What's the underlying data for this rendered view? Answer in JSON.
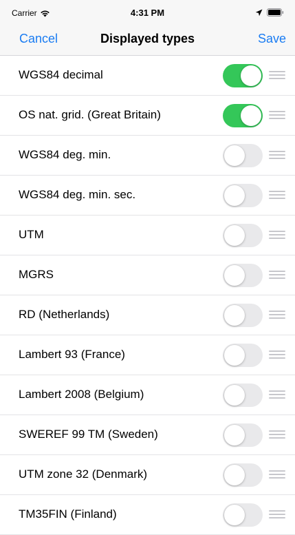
{
  "status_bar": {
    "carrier": "Carrier",
    "time": "4:31 PM",
    "icons": [
      "wifi-icon",
      "location-arrow-icon",
      "battery-icon"
    ]
  },
  "nav": {
    "cancel_label": "Cancel",
    "title": "Displayed types",
    "save_label": "Save"
  },
  "colors": {
    "accent": "#1a7cf2",
    "switch_on": "#34c759",
    "switch_off": "#e9e9eb",
    "separator": "#e3e3e6"
  },
  "types": [
    {
      "label": "WGS84 decimal",
      "enabled": true
    },
    {
      "label": "OS nat. grid. (Great Britain)",
      "enabled": true
    },
    {
      "label": "WGS84 deg. min.",
      "enabled": false
    },
    {
      "label": "WGS84 deg. min. sec.",
      "enabled": false
    },
    {
      "label": "UTM",
      "enabled": false
    },
    {
      "label": "MGRS",
      "enabled": false
    },
    {
      "label": "RD (Netherlands)",
      "enabled": false
    },
    {
      "label": "Lambert 93 (France)",
      "enabled": false
    },
    {
      "label": "Lambert 2008 (Belgium)",
      "enabled": false
    },
    {
      "label": "SWEREF 99 TM (Sweden)",
      "enabled": false
    },
    {
      "label": "UTM zone 32 (Denmark)",
      "enabled": false
    },
    {
      "label": "TM35FIN (Finland)",
      "enabled": false
    }
  ]
}
